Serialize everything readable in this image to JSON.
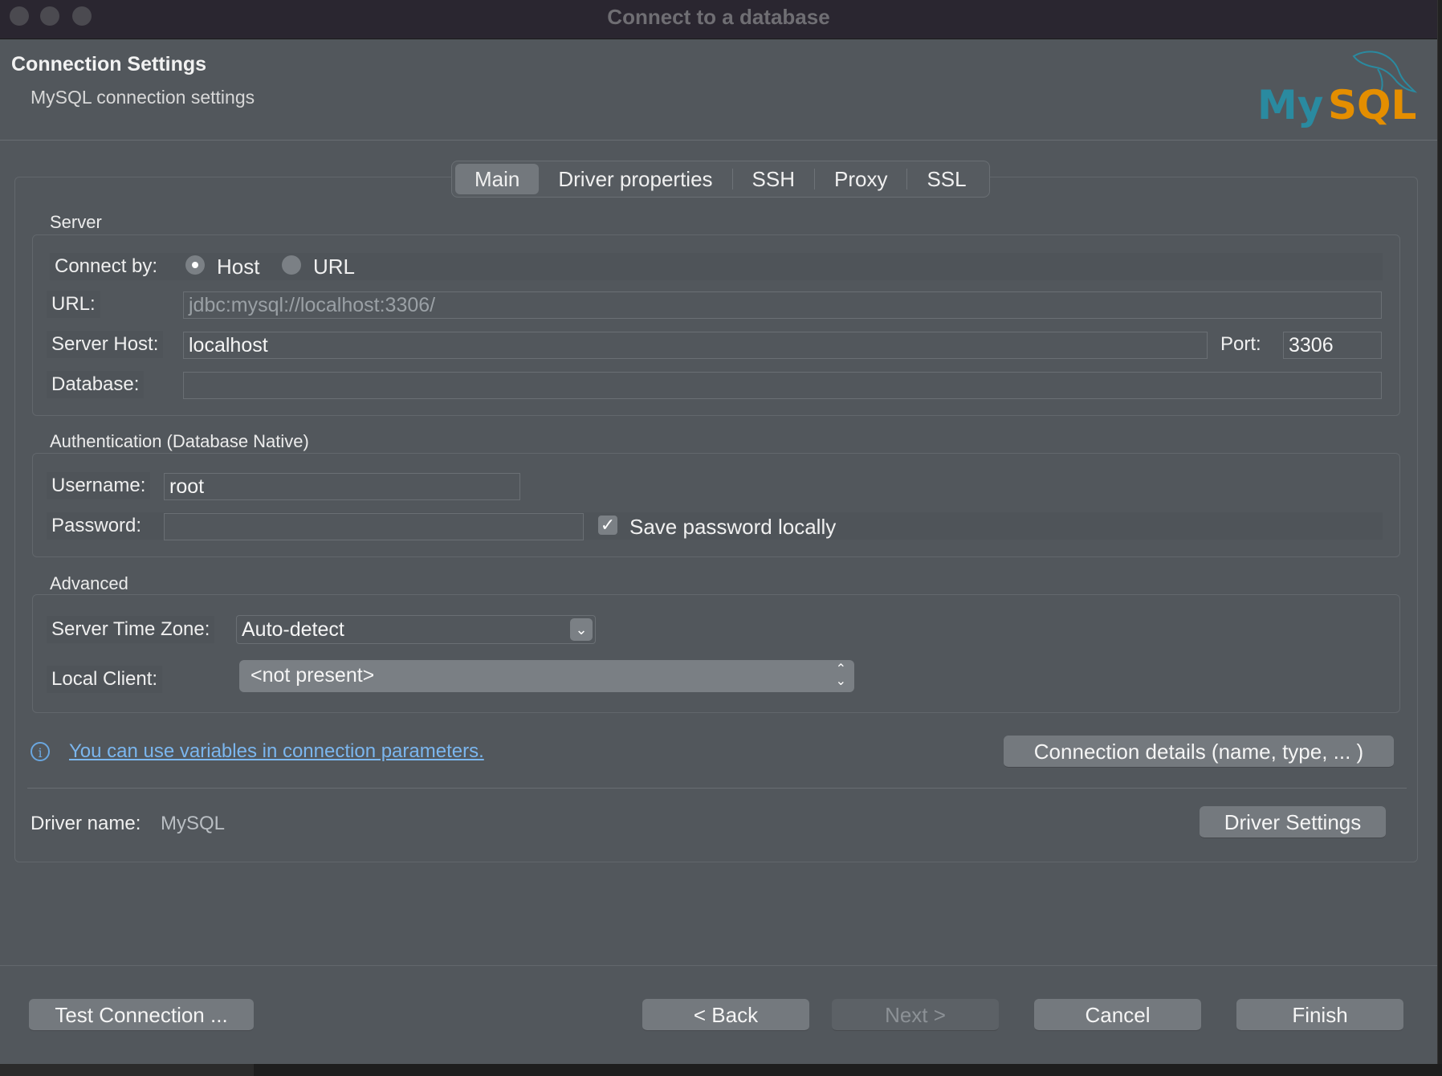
{
  "window": {
    "title": "Connect to a database"
  },
  "header": {
    "title": "Connection Settings",
    "subtitle": "MySQL connection settings",
    "logo_text": "MySQL"
  },
  "tabs": [
    {
      "label": "Main",
      "active": true
    },
    {
      "label": "Driver properties",
      "active": false
    },
    {
      "label": "SSH",
      "active": false
    },
    {
      "label": "Proxy",
      "active": false
    },
    {
      "label": "SSL",
      "active": false
    }
  ],
  "server": {
    "section_label": "Server",
    "connect_by_label": "Connect by:",
    "host_option": "Host",
    "url_option": "URL",
    "selected": "Host",
    "url_label": "URL:",
    "url_value": "jdbc:mysql://localhost:3306/",
    "host_label": "Server Host:",
    "host_value": "localhost",
    "port_label": "Port:",
    "port_value": "3306",
    "database_label": "Database:",
    "database_value": ""
  },
  "auth": {
    "section_label": "Authentication (Database Native)",
    "username_label": "Username:",
    "username_value": "root",
    "password_label": "Password:",
    "password_value": "",
    "save_password_label": "Save password locally",
    "save_password_checked": true
  },
  "advanced": {
    "section_label": "Advanced",
    "timezone_label": "Server Time Zone:",
    "timezone_value": "Auto-detect",
    "local_client_label": "Local Client:",
    "local_client_value": "<not present>"
  },
  "info": {
    "variables_link": "You can use variables in connection parameters.",
    "connection_details_button": "Connection details (name, type, ... )"
  },
  "driver": {
    "label": "Driver name:",
    "value": "MySQL",
    "settings_button": "Driver Settings"
  },
  "footer": {
    "test_button": "Test Connection ...",
    "back_button": "< Back",
    "next_button": "Next >",
    "cancel_button": "Cancel",
    "finish_button": "Finish"
  },
  "colors": {
    "link": "#7bb6ee",
    "logo_teal": "#2a8aa0",
    "logo_orange": "#e48e00"
  }
}
